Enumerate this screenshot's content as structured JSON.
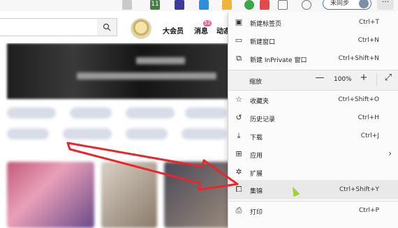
{
  "toolbar": {
    "extension_badge_1": "11",
    "sync_label": "未同步",
    "more_label": "···"
  },
  "page_header": {
    "nav_items": [
      "大会员",
      "消息",
      "动态"
    ],
    "message_badge": "52"
  },
  "menu": {
    "items": [
      {
        "label": "新建标签页",
        "shortcut": "Ctrl+T",
        "icon": "new-tab-icon",
        "glyph": "▣"
      },
      {
        "label": "新建窗口",
        "shortcut": "Ctrl+N",
        "icon": "new-window-icon",
        "glyph": "▭"
      },
      {
        "label": "新建 InPrivate 窗口",
        "shortcut": "Ctrl+Shift+N",
        "icon": "inprivate-window-icon",
        "glyph": "⧉"
      }
    ],
    "zoom": {
      "label": "缩放",
      "value": "100%",
      "minus": "—",
      "plus": "+",
      "fullscreen": "⤢"
    },
    "items2": [
      {
        "label": "收藏夹",
        "shortcut": "Ctrl+Shift+O",
        "icon": "favorites-icon",
        "glyph": "☆"
      },
      {
        "label": "历史记录",
        "shortcut": "Ctrl+H",
        "icon": "history-icon",
        "glyph": "↺"
      },
      {
        "label": "下载",
        "shortcut": "Ctrl+J",
        "icon": "download-icon",
        "glyph": "⤓"
      },
      {
        "label": "应用",
        "shortcut": "",
        "icon": "apps-icon",
        "glyph": "⊞",
        "submenu": "›"
      },
      {
        "label": "扩展",
        "shortcut": "",
        "icon": "extensions-icon",
        "glyph": "✲"
      },
      {
        "label": "集锦",
        "shortcut": "Ctrl+Shift+Y",
        "icon": "collections-icon",
        "glyph": "⧠"
      }
    ],
    "items3": [
      {
        "label": "打印",
        "shortcut": "Ctrl+P",
        "icon": "print-icon",
        "glyph": "⎙"
      }
    ]
  },
  "colors": {
    "accent_red": "#e8262c",
    "sync_border": "#3b78d8",
    "menu_hover": "#e9e9e9",
    "cursor_green": "#9ad33a"
  }
}
